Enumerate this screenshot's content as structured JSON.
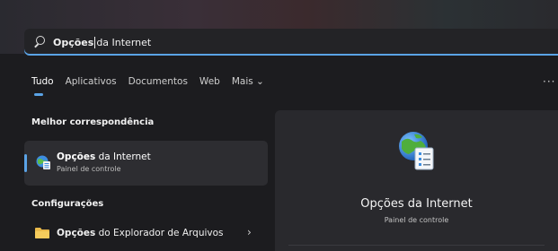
{
  "search": {
    "query_bold": "Opções",
    "query_rest": "da Internet"
  },
  "tabs": [
    {
      "label": "Tudo",
      "active": true
    },
    {
      "label": "Aplicativos"
    },
    {
      "label": "Documentos"
    },
    {
      "label": "Web"
    },
    {
      "label": "Mais ⌄"
    }
  ],
  "more_label": "···",
  "best_match": {
    "section_title": "Melhor correspondência",
    "title_bold": "Opções",
    "title_rest": " da Internet",
    "subtitle": "Painel de controle"
  },
  "settings": {
    "section_title": "Configurações",
    "item_bold": "Opções",
    "item_rest": " do Explorador de Arquivos",
    "chevron": "›"
  },
  "preview": {
    "title": "Opções da Internet",
    "subtitle": "Painel de controle"
  },
  "colors": {
    "accent": "#5aa3e6",
    "card": "#2d2d31",
    "preview_bg": "#29292d"
  }
}
